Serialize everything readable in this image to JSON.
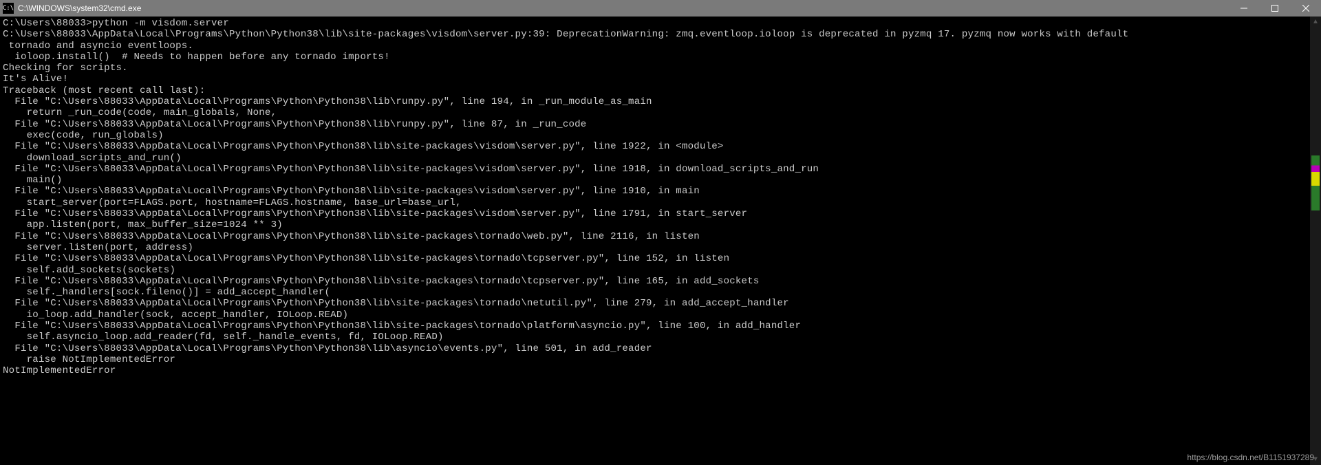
{
  "window": {
    "title": "C:\\WINDOWS\\system32\\cmd.exe"
  },
  "terminal": {
    "lines": [
      "C:\\Users\\88033>python -m visdom.server",
      "C:\\Users\\88033\\AppData\\Local\\Programs\\Python\\Python38\\lib\\site-packages\\visdom\\server.py:39: DeprecationWarning: zmq.eventloop.ioloop is deprecated in pyzmq 17. pyzmq now works with default",
      " tornado and asyncio eventloops.",
      "  ioloop.install()  # Needs to happen before any tornado imports!",
      "Checking for scripts.",
      "It's Alive!",
      "Traceback (most recent call last):",
      "  File \"C:\\Users\\88033\\AppData\\Local\\Programs\\Python\\Python38\\lib\\runpy.py\", line 194, in _run_module_as_main",
      "    return _run_code(code, main_globals, None,",
      "  File \"C:\\Users\\88033\\AppData\\Local\\Programs\\Python\\Python38\\lib\\runpy.py\", line 87, in _run_code",
      "    exec(code, run_globals)",
      "  File \"C:\\Users\\88033\\AppData\\Local\\Programs\\Python\\Python38\\lib\\site-packages\\visdom\\server.py\", line 1922, in <module>",
      "    download_scripts_and_run()",
      "  File \"C:\\Users\\88033\\AppData\\Local\\Programs\\Python\\Python38\\lib\\site-packages\\visdom\\server.py\", line 1918, in download_scripts_and_run",
      "    main()",
      "  File \"C:\\Users\\88033\\AppData\\Local\\Programs\\Python\\Python38\\lib\\site-packages\\visdom\\server.py\", line 1910, in main",
      "    start_server(port=FLAGS.port, hostname=FLAGS.hostname, base_url=base_url,",
      "  File \"C:\\Users\\88033\\AppData\\Local\\Programs\\Python\\Python38\\lib\\site-packages\\visdom\\server.py\", line 1791, in start_server",
      "    app.listen(port, max_buffer_size=1024 ** 3)",
      "  File \"C:\\Users\\88033\\AppData\\Local\\Programs\\Python\\Python38\\lib\\site-packages\\tornado\\web.py\", line 2116, in listen",
      "    server.listen(port, address)",
      "  File \"C:\\Users\\88033\\AppData\\Local\\Programs\\Python\\Python38\\lib\\site-packages\\tornado\\tcpserver.py\", line 152, in listen",
      "    self.add_sockets(sockets)",
      "  File \"C:\\Users\\88033\\AppData\\Local\\Programs\\Python\\Python38\\lib\\site-packages\\tornado\\tcpserver.py\", line 165, in add_sockets",
      "    self._handlers[sock.fileno()] = add_accept_handler(",
      "  File \"C:\\Users\\88033\\AppData\\Local\\Programs\\Python\\Python38\\lib\\site-packages\\tornado\\netutil.py\", line 279, in add_accept_handler",
      "    io_loop.add_handler(sock, accept_handler, IOLoop.READ)",
      "  File \"C:\\Users\\88033\\AppData\\Local\\Programs\\Python\\Python38\\lib\\site-packages\\tornado\\platform\\asyncio.py\", line 100, in add_handler",
      "    self.asyncio_loop.add_reader(fd, self._handle_events, fd, IOLoop.READ)",
      "  File \"C:\\Users\\88033\\AppData\\Local\\Programs\\Python\\Python38\\lib\\asyncio\\events.py\", line 501, in add_reader",
      "    raise NotImplementedError",
      "NotImplementedError"
    ]
  },
  "watermark": "https://blog.csdn.net/B1151937289"
}
